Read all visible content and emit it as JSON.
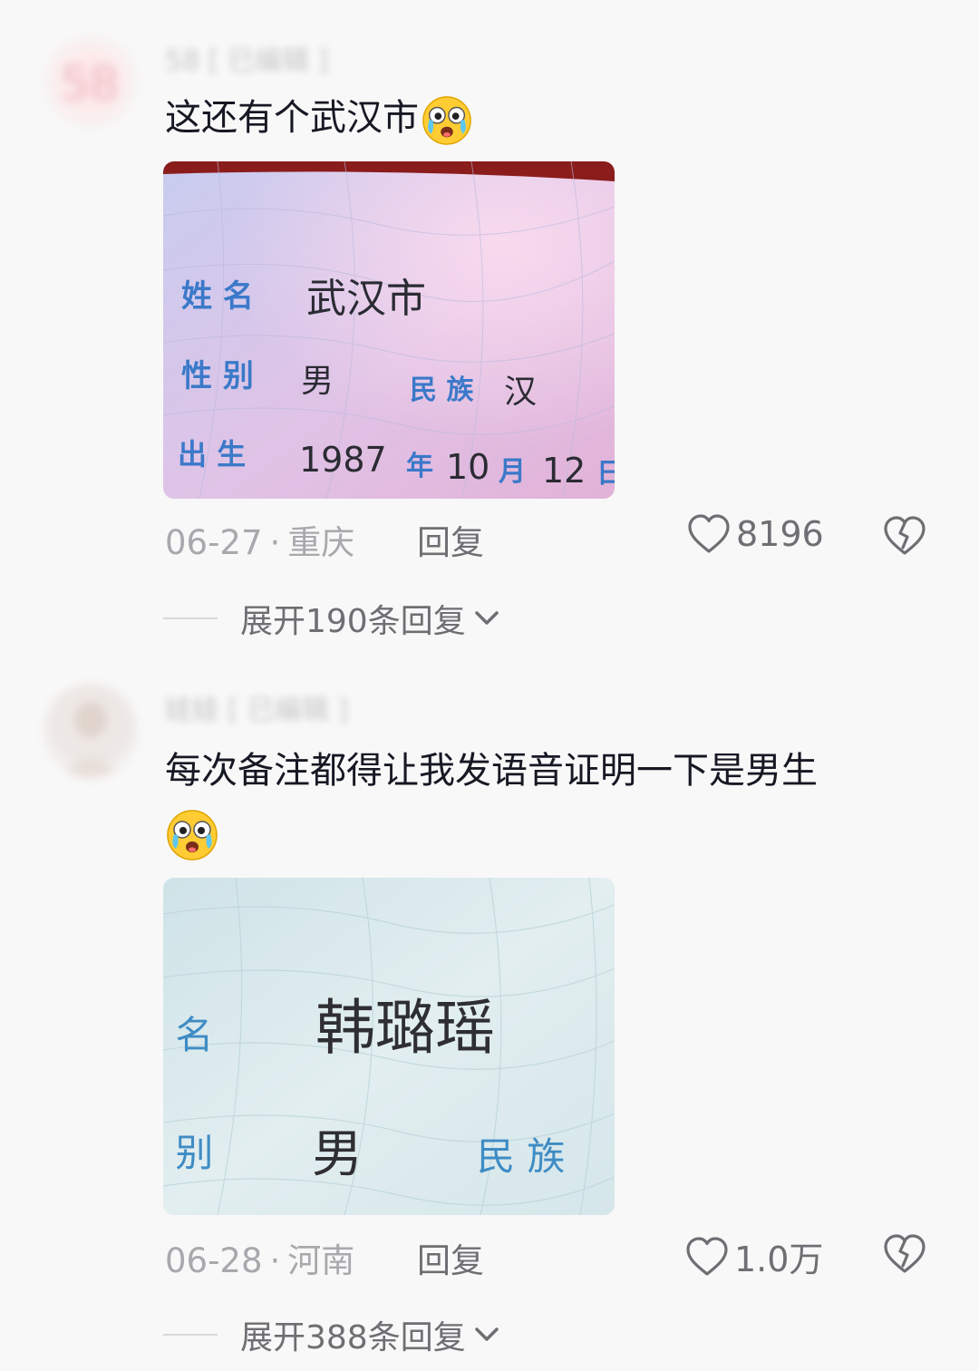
{
  "comments": [
    {
      "username": "58 [ 已编辑 ]",
      "text": "这还有个武汉市",
      "emoji_icon": "crying-laughing-emoji",
      "photo": {
        "name_label": "姓  名",
        "name_value": "武汉市",
        "gender_label": "性  别",
        "gender_value": "男",
        "ethnicity_label": "民  族",
        "ethnicity_value": "汉",
        "birth_label": "出  生",
        "birth_year": "1987",
        "year_char": "年",
        "birth_month": "10",
        "month_char": "月",
        "birth_day": "12",
        "day_char": "日"
      },
      "date": "06-27",
      "location": "重庆",
      "reply_label": "回复",
      "likes": "8196",
      "expand_label": "展开190条回复"
    },
    {
      "username": "娃娃 [ 已编辑 ]",
      "text": "每次备注都得让我发语音证明一下是男生",
      "emoji_icon": "crying-laughing-emoji",
      "photo": {
        "name_label": "姓  名",
        "name_value": "韩璐瑶",
        "gender_label": "性  别",
        "gender_value": "男",
        "ethnicity_label": "民  族"
      },
      "date": "06-28",
      "location": "河南",
      "reply_label": "回复",
      "likes": "1.0万",
      "expand_label": "展开388条回复"
    }
  ],
  "colors": {
    "background": "#f8f8f8",
    "text": "#161823",
    "meta": "#a8a8ad",
    "action": "#6e6e73"
  },
  "separator": "·"
}
